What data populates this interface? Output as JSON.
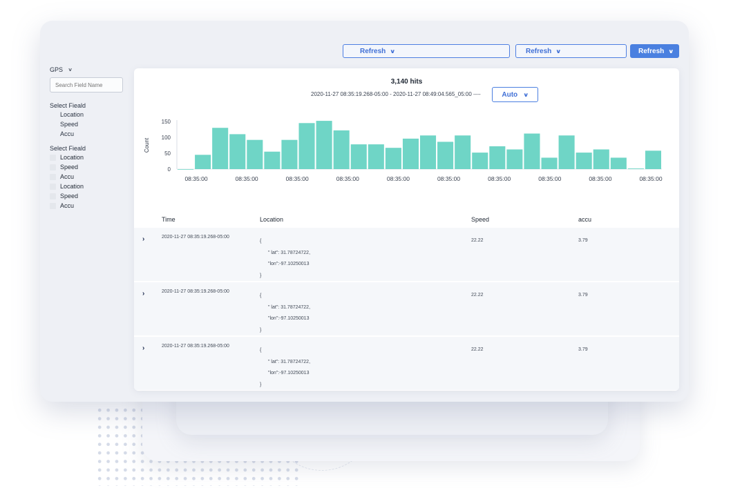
{
  "toolbar": {
    "refresh_1": "Refresh",
    "refresh_2": "Refresh",
    "refresh_3": "Refresh"
  },
  "sidebar": {
    "index": "GPS",
    "search_placeholder": "Search Field Name",
    "section_1_title": "Select Fieald",
    "section_1_fields": [
      "Location",
      "Speed",
      "Accu"
    ],
    "section_2_title": "Select Fieald",
    "section_2_fields": [
      "Location",
      "Speed",
      "Accu",
      "Location",
      "Speed",
      "Accu"
    ]
  },
  "summary": {
    "hits": "3,140 hits",
    "range": "2020-11-27 08:35:19.268-05:00 - 2020-11-27 08:49:04.565_05:00 ----",
    "interval": "Auto"
  },
  "colors": {
    "bar": "#6fd5c6",
    "accent": "#4a80e0"
  },
  "chart_data": {
    "type": "bar",
    "ylabel": "Count",
    "ylim": [
      0,
      150
    ],
    "yticks": [
      0,
      50,
      100,
      150
    ],
    "x_tick_labels": [
      "08:35:00",
      "08:35:00",
      "08:35:00",
      "08:35:00",
      "08:35:00",
      "08:35:00",
      "08:35:00",
      "08:35:00",
      "08:35:00",
      "08:35:00"
    ],
    "values": [
      0,
      45,
      130,
      110,
      92,
      55,
      92,
      145,
      152,
      122,
      78,
      78,
      67,
      96,
      106,
      86,
      106,
      52,
      72,
      62,
      112,
      36,
      106,
      52,
      62,
      36,
      2,
      58
    ]
  },
  "table": {
    "columns": [
      "Time",
      "Location",
      "Speed",
      "accu"
    ],
    "rows": [
      {
        "time": "2020-11-27 08:35:19.268-05:00",
        "open": "{",
        "lat": "\" lat\": 31.78724722,",
        "lon": "\"lon\":-97.10250013",
        "close": "}",
        "speed": "22.22",
        "accu": "3.79"
      },
      {
        "time": "2020-11-27 08:35:19.268-05:00",
        "open": "{",
        "lat": "\" lat\": 31.78724722,",
        "lon": "\"lon\":-97.10250013",
        "close": "}",
        "speed": "22.22",
        "accu": "3.79"
      },
      {
        "time": "2020-11-27 08:35:19.268-05:00",
        "open": "{",
        "lat": "\" lat\": 31.78724722,",
        "lon": "\"lon\":-97.10250013",
        "close": "}",
        "speed": "22.22",
        "accu": "3.79"
      }
    ]
  }
}
